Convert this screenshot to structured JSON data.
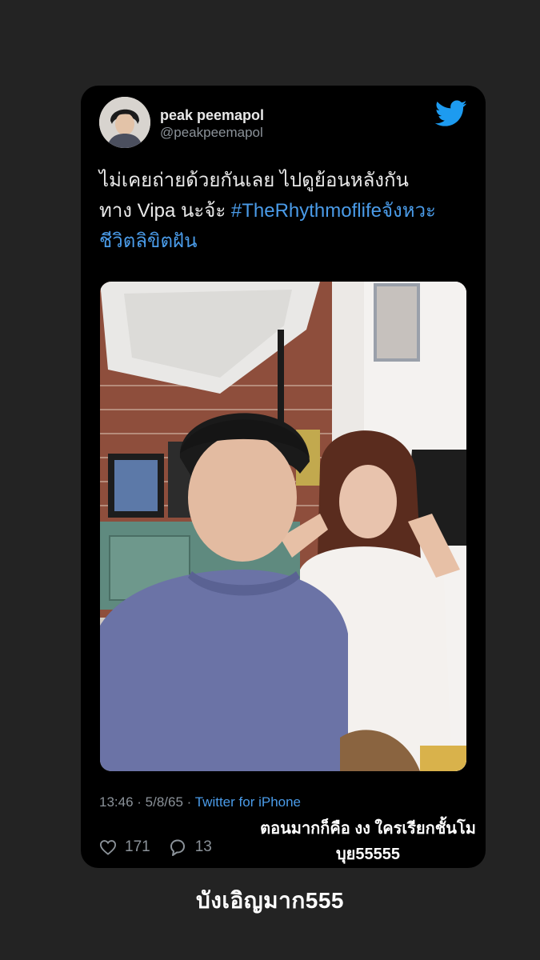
{
  "tweet": {
    "display_name": "peak peemapol",
    "handle": "@peakpeemapol",
    "text_line1": "ไม่เคยถ่ายด้วยกันเลย ไปดูย้อนหลังกัน",
    "text_line2_plain": "ทาง Vipa นะจ้ะ ",
    "hashtag_part1": "#TheRhythmoflifeจังหวะ",
    "hashtag_part2": "ชีวิตลิขิตฝัน",
    "time": "13:46",
    "separator1": " · ",
    "date": "5/8/65",
    "separator2": " · ",
    "source": "Twitter for iPhone",
    "likes": "171",
    "replies": "13",
    "photo_alt": "Selfie photo"
  },
  "story": {
    "overlay_caption_line1": "ตอนมากก็คือ งง ใครเรียกชั้นโม",
    "overlay_caption_line2": "บุย55555",
    "bottom_caption": "บังเอิญมาก555"
  },
  "colors": {
    "background": "#232323",
    "card": "#000000",
    "link": "#4a9be8",
    "twitter_blue": "#1d9bf0",
    "muted_text": "#8b9299"
  },
  "icons": {
    "bird": "twitter-bird-icon",
    "like": "heart-icon",
    "reply": "reply-bubble-icon"
  }
}
